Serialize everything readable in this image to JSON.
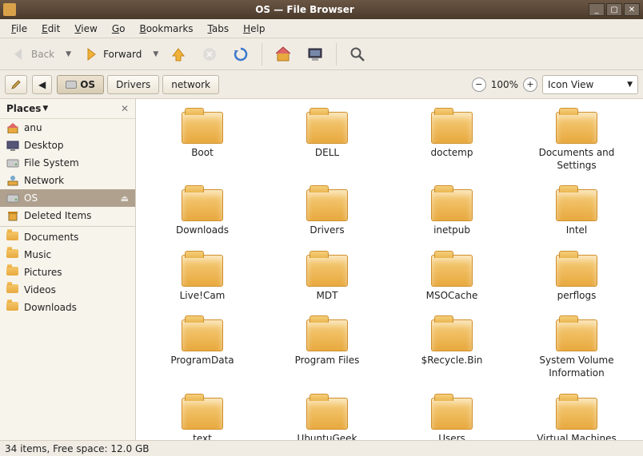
{
  "window": {
    "title": "OS — File Browser"
  },
  "menus": {
    "file": "File",
    "edit": "Edit",
    "view": "View",
    "go": "Go",
    "bookmarks": "Bookmarks",
    "tabs": "Tabs",
    "help": "Help"
  },
  "toolbar": {
    "back": "Back",
    "forward": "Forward"
  },
  "location": {
    "crumbs": [
      {
        "label": "OS",
        "active": true,
        "hasDisk": true
      },
      {
        "label": "Drivers",
        "active": false
      },
      {
        "label": "network",
        "active": false
      }
    ],
    "zoom": "100%",
    "view_mode": "Icon View"
  },
  "sidebar": {
    "header": "Places",
    "items": [
      {
        "name": "anu",
        "icon": "home",
        "selected": false
      },
      {
        "name": "Desktop",
        "icon": "desktop",
        "selected": false
      },
      {
        "name": "File System",
        "icon": "disk",
        "selected": false
      },
      {
        "name": "Network",
        "icon": "network",
        "selected": false
      },
      {
        "name": "OS",
        "icon": "disk",
        "selected": true,
        "eject": true
      },
      {
        "name": "Deleted Items",
        "icon": "trash",
        "selected": false
      }
    ],
    "bookmarks": [
      {
        "name": "Documents"
      },
      {
        "name": "Music"
      },
      {
        "name": "Pictures"
      },
      {
        "name": "Videos"
      },
      {
        "name": "Downloads"
      }
    ]
  },
  "folders": [
    "Boot",
    "DELL",
    "doctemp",
    "Documents and Settings",
    "Downloads",
    "Drivers",
    "inetpub",
    "Intel",
    "Live!Cam",
    "MDT",
    "MSOCache",
    "perflogs",
    "ProgramData",
    "Program Files",
    "$Recycle.Bin",
    "System Volume Information",
    "text",
    "UbuntuGeek",
    "Users",
    "Virtual Machines"
  ],
  "status": "34 items, Free space: 12.0 GB"
}
